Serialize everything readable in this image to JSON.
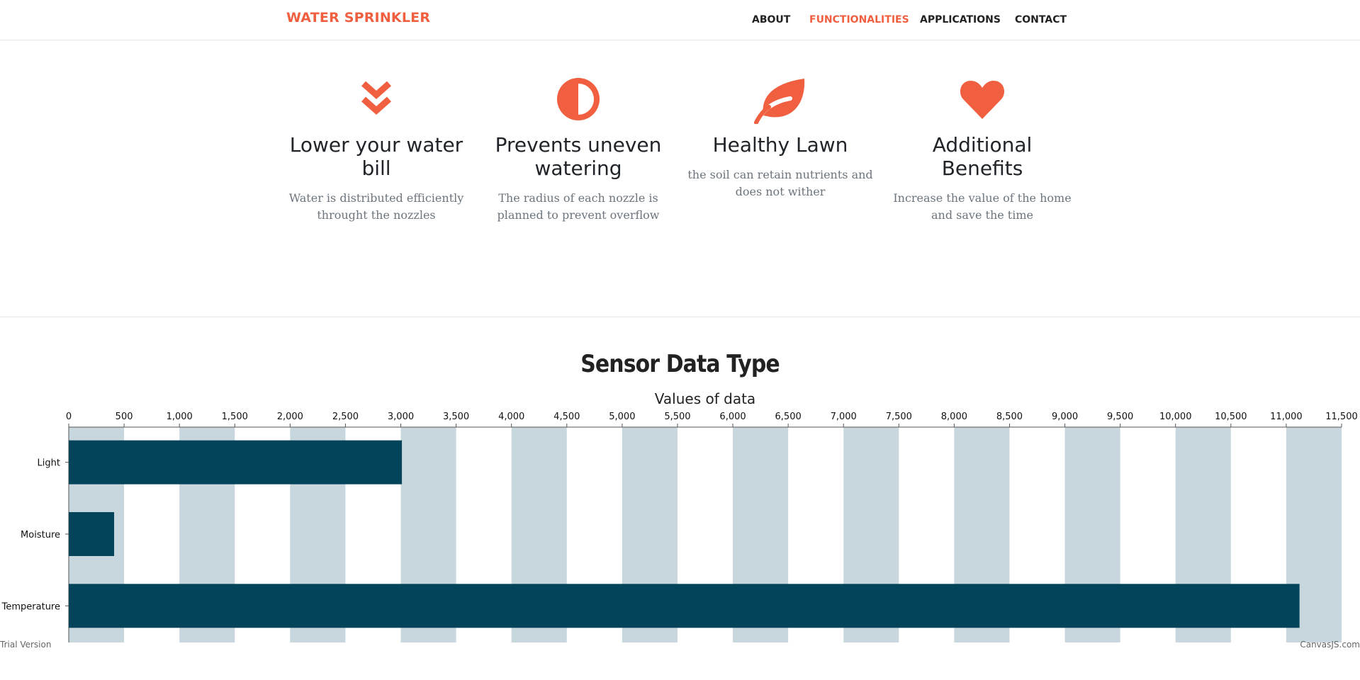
{
  "brand": "WATER SPRINKLER",
  "nav": [
    {
      "label": "ABOUT",
      "active": false
    },
    {
      "label": "FUNCTIONALITIES",
      "active": true
    },
    {
      "label": "APPLICATIONS",
      "active": false
    },
    {
      "label": "CONTACT",
      "active": false
    }
  ],
  "features": [
    {
      "icon": "double-chevron-down-icon",
      "title": "Lower your water bill",
      "text": "Water is distributed efficiently throught the nozzles"
    },
    {
      "icon": "half-circle-icon",
      "title": "Prevents uneven watering",
      "text": "The radius of each nozzle is planned to prevent overflow"
    },
    {
      "icon": "leaf-icon",
      "title": "Healthy Lawn",
      "text": "the soil can retain nutrients and does not wither"
    },
    {
      "icon": "heart-icon",
      "title": "Additional Benefits",
      "text": "Increase the value of the home and save the time"
    }
  ],
  "colors": {
    "accent": "#f05f40",
    "bar": "#03445a",
    "stripe": "#c7d7dd"
  },
  "chart_data": {
    "type": "bar",
    "orientation": "horizontal",
    "title": "Sensor Data Type",
    "ylabel": "Values of data",
    "categories": [
      "Light",
      "Moisture",
      "Temperature"
    ],
    "values": [
      3010,
      410,
      11120
    ],
    "ylim": [
      0,
      11500
    ],
    "tick_interval": 500,
    "tick_labels": [
      "0",
      "500",
      "1,000",
      "1,500",
      "2,000",
      "2,500",
      "3,000",
      "3,500",
      "4,000",
      "4,500",
      "5,000",
      "5,500",
      "6,000",
      "6,500",
      "7,000",
      "7,500",
      "8,000",
      "8,500",
      "9,000",
      "9,500",
      "10,000",
      "10,500",
      "11,000",
      "11,500"
    ],
    "interlaced_bands": true,
    "axis_position": "top"
  },
  "watermark_left": "Trial Version",
  "watermark_right": "CanvasJS.com"
}
